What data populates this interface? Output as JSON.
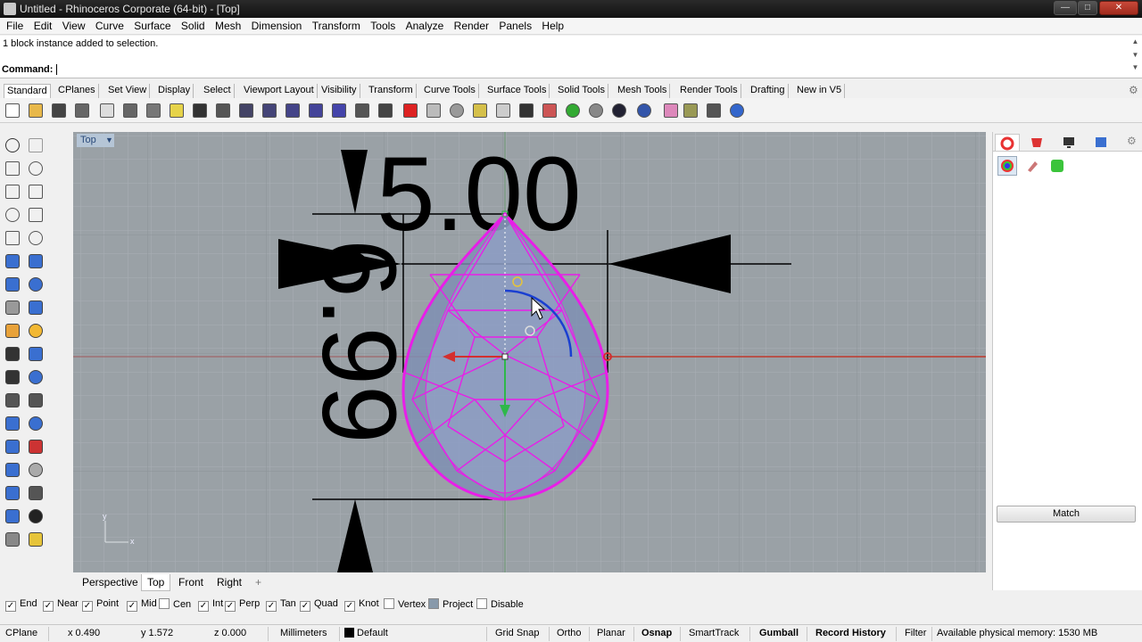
{
  "window": {
    "title": "Untitled - Rhinoceros Corporate (64-bit) - [Top]",
    "minimize": "—",
    "maximize": "□",
    "close": "✕"
  },
  "menu": [
    "File",
    "Edit",
    "View",
    "Curve",
    "Surface",
    "Solid",
    "Mesh",
    "Dimension",
    "Transform",
    "Tools",
    "Analyze",
    "Render",
    "Panels",
    "Help"
  ],
  "command": {
    "history": "1 block instance added to selection.",
    "prompt": "Command:",
    "value": ""
  },
  "toolbar_tabs": [
    "Standard",
    "CPlanes",
    "Set View",
    "Display",
    "Select",
    "Viewport Layout",
    "Visibility",
    "Transform",
    "Curve Tools",
    "Surface Tools",
    "Solid Tools",
    "Mesh Tools",
    "Render Tools",
    "Drafting",
    "New in V5"
  ],
  "toolbar_icons": [
    "new-icon",
    "open-icon",
    "save-icon",
    "print-icon",
    "import-icon",
    "cut-icon",
    "copy-icon",
    "paste-icon",
    "undo-icon",
    "pan-hand-icon",
    "move-view-icon",
    "zoom-dynamic-icon",
    "zoom-window-icon",
    "zoom-extents-icon",
    "zoom-selected-icon",
    "rotate-view-icon",
    "viewport-layout-icon",
    "car-icon",
    "cloud-icon",
    "circle-icon",
    "grid-icon",
    "lightbulb-icon",
    "lock-icon",
    "layers-icon",
    "color-wheel-icon",
    "shaded-sphere-icon",
    "render-sphere-icon",
    "material-sphere-icon",
    "light-icon",
    "gear-icon",
    "snap-icon",
    "help-icon"
  ],
  "left_tools": [
    "select-arrow-icon",
    "point-icon",
    "polyline-icon",
    "curve-icon",
    "circle-icon",
    "ellipse-icon",
    "arc-icon",
    "rectangle-icon",
    "polygon-icon",
    "fillet-icon",
    "surface-icon",
    "surface-patch-icon",
    "box-icon",
    "sphere-icon",
    "cylinder-icon",
    "mesh-icon",
    "explode-icon",
    "lightning-icon",
    "trim-icon",
    "split-icon",
    "boolean-icon",
    "group-icon",
    "offset-icon",
    "blend-icon",
    "text-icon",
    "transform-icon",
    "array-icon",
    "mirror-icon",
    "solid-edit-icon",
    "dim-icon",
    "grid-array-icon",
    "align-icon",
    "analyze-icon",
    "check-icon",
    "render-icon",
    "paint-icon"
  ],
  "viewport": {
    "name": "Top",
    "dim_horizontal": "5.00",
    "dim_vertical": "6.99",
    "axis_x": "x",
    "axis_y": "y"
  },
  "viewport_tabs": [
    "Perspective",
    "Top",
    "Front",
    "Right"
  ],
  "viewport_add": "+",
  "right_panel": {
    "match_label": "Match"
  },
  "osnaps": [
    {
      "label": "End",
      "checked": true
    },
    {
      "label": "Near",
      "checked": true
    },
    {
      "label": "Point",
      "checked": true
    },
    {
      "label": "Mid",
      "checked": true
    },
    {
      "label": "Cen",
      "checked": false
    },
    {
      "label": "Int",
      "checked": true
    },
    {
      "label": "Perp",
      "checked": true
    },
    {
      "label": "Tan",
      "checked": true
    },
    {
      "label": "Quad",
      "checked": true
    },
    {
      "label": "Knot",
      "checked": true
    },
    {
      "label": "Vertex",
      "checked": false
    },
    {
      "label": "Project",
      "checked": true
    },
    {
      "label": "Disable",
      "checked": false
    }
  ],
  "status": {
    "cplane": "CPlane",
    "x": "x 0.490",
    "y": "y 1.572",
    "z": "z 0.000",
    "units": "Millimeters",
    "layer": "Default",
    "grid_snap": "Grid Snap",
    "ortho": "Ortho",
    "planar": "Planar",
    "osnap": "Osnap",
    "smarttrack": "SmartTrack",
    "gumball": "Gumball",
    "record_history": "Record History",
    "filter": "Filter",
    "memory": "Available physical memory: 1530 MB"
  },
  "colors": {
    "viewport_bg": "#9aa1a6",
    "selection_magenta": "#e81ee8",
    "x_axis_red": "#c0392b",
    "y_axis_green": "#27ae60",
    "arc_blue": "#1a3fd1"
  }
}
